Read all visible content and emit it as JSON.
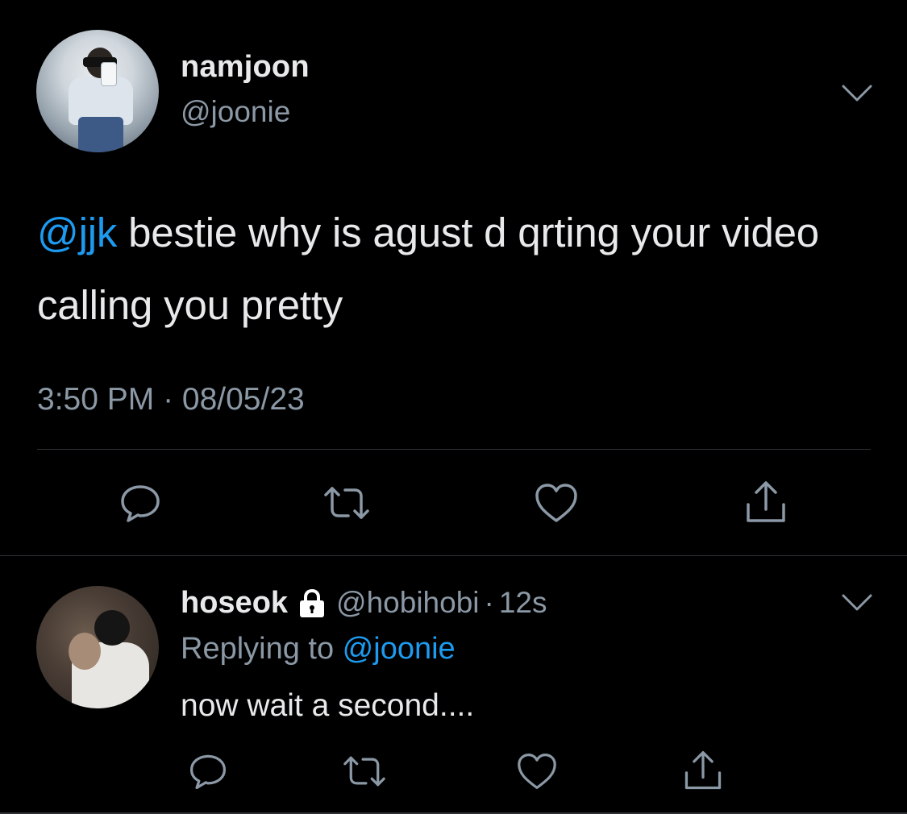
{
  "colors": {
    "background": "#000000",
    "text_primary": "#e7e9ea",
    "text_secondary": "#8b98a5",
    "accent": "#1d9bf0",
    "divider": "#2f3336"
  },
  "main_tweet": {
    "display_name": "namjoon",
    "handle": "@joonie",
    "mention": "@jjk",
    "text": " bestie why is agust d qrting your video calling you pretty",
    "timestamp": "3:50 PM · 08/05/23",
    "icons": [
      "chevron-down-icon",
      "reply-icon",
      "retweet-icon",
      "like-icon",
      "share-icon"
    ]
  },
  "reply_tweet": {
    "display_name": "hoseok",
    "protected_icon": "lock-icon",
    "handle": "@hobihobi",
    "separator": "·",
    "time": "12s",
    "replying_prefix": "Replying to ",
    "replying_to": "@joonie",
    "text": "now wait a second....",
    "icons": [
      "chevron-down-icon",
      "reply-icon",
      "retweet-icon",
      "like-icon",
      "share-icon"
    ]
  }
}
